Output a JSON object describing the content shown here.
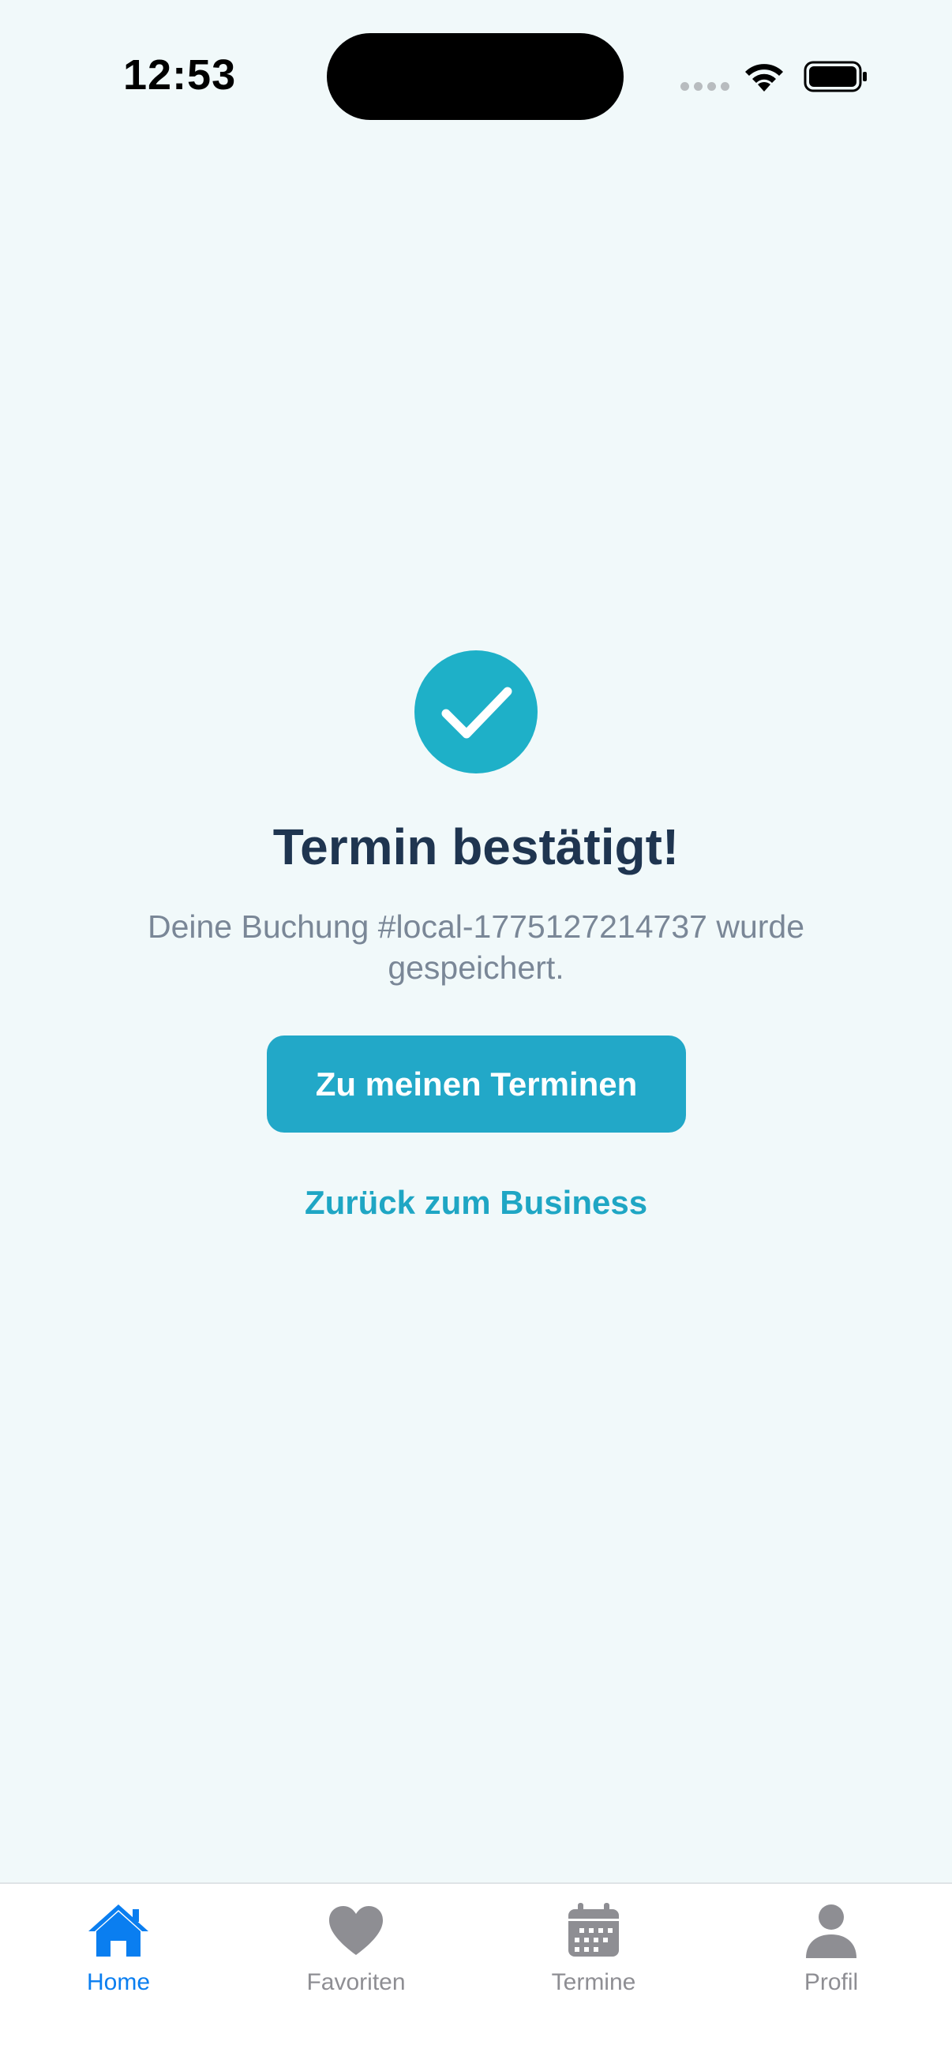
{
  "status_bar": {
    "time": "12:53"
  },
  "confirmation": {
    "title": "Termin bestätigt!",
    "message": "Deine Buchung #local-1775127214737 wurde gespeichert.",
    "primary_button": "Zu meinen Terminen",
    "secondary_link": "Zurück zum Business"
  },
  "tab_bar": {
    "items": [
      {
        "label": "Home",
        "icon": "home-icon",
        "active": true
      },
      {
        "label": "Favoriten",
        "icon": "heart-icon",
        "active": false
      },
      {
        "label": "Termine",
        "icon": "calendar-icon",
        "active": false
      },
      {
        "label": "Profil",
        "icon": "person-icon",
        "active": false
      }
    ]
  },
  "colors": {
    "accent": "#22a8c8",
    "tab_active": "#0a7ef0",
    "tab_inactive": "#8e8e93",
    "background": "#f1f9fa",
    "title": "#1f3550"
  }
}
